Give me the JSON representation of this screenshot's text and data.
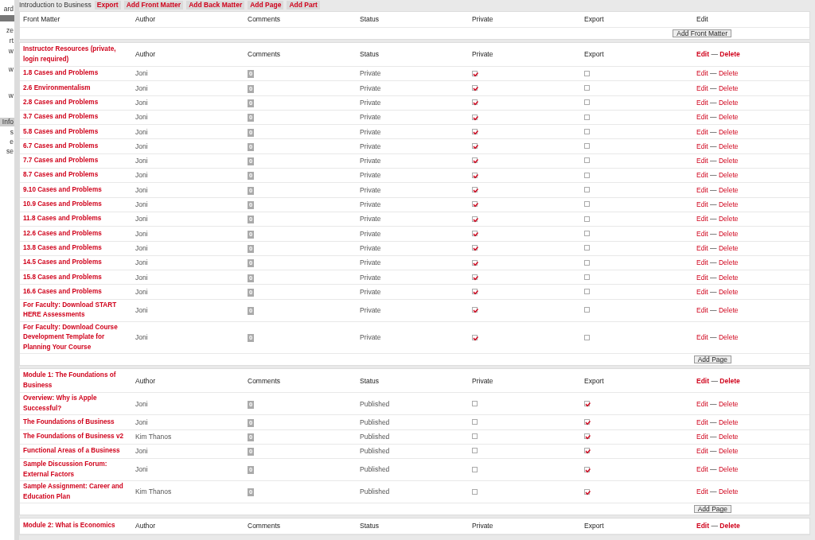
{
  "sidebar": {
    "items": [
      {
        "label": "ard",
        "selected": false
      },
      {
        "label": "ze",
        "selected": false
      },
      {
        "label": "rt",
        "selected": false
      },
      {
        "label": "w",
        "selected": false
      },
      {
        "label": "w",
        "selected": false
      },
      {
        "label": "w",
        "selected": false
      },
      {
        "label": "Info",
        "selected": true
      },
      {
        "label": "s",
        "selected": false
      },
      {
        "label": "e",
        "selected": false
      },
      {
        "label": "se",
        "selected": false
      }
    ]
  },
  "toolbar": {
    "book_title": "Introduction to Business",
    "buttons": [
      "Export",
      "Add Front Matter",
      "Add Back Matter",
      "Add Page",
      "Add Part"
    ]
  },
  "sections": [
    {
      "kind": "front_matter",
      "title": "Front Matter",
      "columns": [
        "Author",
        "Comments",
        "Status",
        "Private",
        "Export"
      ],
      "edit": "Edit",
      "add_button": "Add Front Matter"
    },
    {
      "kind": "part",
      "title": "Instructor Resources (private, login required)",
      "columns": [
        "Author",
        "Comments",
        "Status",
        "Private",
        "Export"
      ],
      "edit": "Edit",
      "separator": "—",
      "delete": "Delete",
      "add_button": "Add Page",
      "rows": [
        {
          "title": "1.8 Cases and Problems",
          "author": "Joni",
          "comments": "0",
          "status": "Private",
          "private": true,
          "export": false,
          "edit": "Edit",
          "separator": "—",
          "delete": "Delete"
        },
        {
          "title": "2.6 Environmentalism",
          "author": "Joni",
          "comments": "0",
          "status": "Private",
          "private": true,
          "export": false,
          "edit": "Edit",
          "separator": "—",
          "delete": "Delete"
        },
        {
          "title": "2.8 Cases and Problems",
          "author": "Joni",
          "comments": "0",
          "status": "Private",
          "private": true,
          "export": false,
          "edit": "Edit",
          "separator": "—",
          "delete": "Delete"
        },
        {
          "title": "3.7 Cases and Problems",
          "author": "Joni",
          "comments": "0",
          "status": "Private",
          "private": true,
          "export": false,
          "edit": "Edit",
          "separator": "—",
          "delete": "Delete"
        },
        {
          "title": "5.8 Cases and Problems",
          "author": "Joni",
          "comments": "0",
          "status": "Private",
          "private": true,
          "export": false,
          "edit": "Edit",
          "separator": "—",
          "delete": "Delete"
        },
        {
          "title": "6.7 Cases and Problems",
          "author": "Joni",
          "comments": "0",
          "status": "Private",
          "private": true,
          "export": false,
          "edit": "Edit",
          "separator": "—",
          "delete": "Delete"
        },
        {
          "title": "7.7 Cases and Problems",
          "author": "Joni",
          "comments": "0",
          "status": "Private",
          "private": true,
          "export": false,
          "edit": "Edit",
          "separator": "—",
          "delete": "Delete"
        },
        {
          "title": "8.7 Cases and Problems",
          "author": "Joni",
          "comments": "0",
          "status": "Private",
          "private": true,
          "export": false,
          "edit": "Edit",
          "separator": "—",
          "delete": "Delete"
        },
        {
          "title": "9.10 Cases and Problems",
          "author": "Joni",
          "comments": "0",
          "status": "Private",
          "private": true,
          "export": false,
          "edit": "Edit",
          "separator": "—",
          "delete": "Delete"
        },
        {
          "title": "10.9 Cases and Problems",
          "author": "Joni",
          "comments": "0",
          "status": "Private",
          "private": true,
          "export": false,
          "edit": "Edit",
          "separator": "—",
          "delete": "Delete"
        },
        {
          "title": "11.8 Cases and Problems",
          "author": "Joni",
          "comments": "0",
          "status": "Private",
          "private": true,
          "export": false,
          "edit": "Edit",
          "separator": "—",
          "delete": "Delete"
        },
        {
          "title": "12.6 Cases and Problems",
          "author": "Joni",
          "comments": "0",
          "status": "Private",
          "private": true,
          "export": false,
          "edit": "Edit",
          "separator": "—",
          "delete": "Delete"
        },
        {
          "title": "13.8 Cases and Problems",
          "author": "Joni",
          "comments": "0",
          "status": "Private",
          "private": true,
          "export": false,
          "edit": "Edit",
          "separator": "—",
          "delete": "Delete"
        },
        {
          "title": "14.5 Cases and Problems",
          "author": "Joni",
          "comments": "0",
          "status": "Private",
          "private": true,
          "export": false,
          "edit": "Edit",
          "separator": "—",
          "delete": "Delete"
        },
        {
          "title": "15.8 Cases and Problems",
          "author": "Joni",
          "comments": "0",
          "status": "Private",
          "private": true,
          "export": false,
          "edit": "Edit",
          "separator": "—",
          "delete": "Delete"
        },
        {
          "title": "16.6 Cases and Problems",
          "author": "Joni",
          "comments": "0",
          "status": "Private",
          "private": true,
          "export": false,
          "edit": "Edit",
          "separator": "—",
          "delete": "Delete"
        },
        {
          "title": "For Faculty: Download START HERE Assessments",
          "author": "Joni",
          "comments": "0",
          "status": "Private",
          "private": true,
          "export": false,
          "edit": "Edit",
          "separator": "—",
          "delete": "Delete"
        },
        {
          "title": "For Faculty: Download Course Development Template for Planning Your Course",
          "author": "Joni",
          "comments": "0",
          "status": "Private",
          "private": true,
          "export": false,
          "edit": "Edit",
          "separator": "—",
          "delete": "Delete"
        }
      ]
    },
    {
      "kind": "part",
      "title": "Module 1: The Foundations of Business",
      "columns": [
        "Author",
        "Comments",
        "Status",
        "Private",
        "Export"
      ],
      "edit": "Edit",
      "separator": "—",
      "delete": "Delete",
      "add_button": "Add Page",
      "rows": [
        {
          "title": "Overview: Why is Apple Successful?",
          "author": "Joni",
          "comments": "0",
          "status": "Published",
          "private": false,
          "export": true,
          "edit": "Edit",
          "separator": "—",
          "delete": "Delete"
        },
        {
          "title": "The Foundations of Business",
          "author": "Joni",
          "comments": "0",
          "status": "Published",
          "private": false,
          "export": true,
          "edit": "Edit",
          "separator": "—",
          "delete": "Delete"
        },
        {
          "title": "The Foundations of Business v2",
          "author": "Kim Thanos",
          "comments": "0",
          "status": "Published",
          "private": false,
          "export": true,
          "edit": "Edit",
          "separator": "—",
          "delete": "Delete"
        },
        {
          "title": "Functional Areas of a Business",
          "author": "Joni",
          "comments": "0",
          "status": "Published",
          "private": false,
          "export": true,
          "edit": "Edit",
          "separator": "—",
          "delete": "Delete"
        },
        {
          "title": "Sample Discussion Forum: External Factors",
          "author": "Joni",
          "comments": "0",
          "status": "Published",
          "private": false,
          "export": true,
          "edit": "Edit",
          "separator": "—",
          "delete": "Delete"
        },
        {
          "title": "Sample Assignment: Career and Education Plan",
          "author": "Kim Thanos",
          "comments": "0",
          "status": "Published",
          "private": false,
          "export": true,
          "edit": "Edit",
          "separator": "—",
          "delete": "Delete"
        }
      ]
    },
    {
      "kind": "part",
      "title": "Module 2: What is Economics",
      "columns": [
        "Author",
        "Comments",
        "Status",
        "Private",
        "Export"
      ],
      "edit": "Edit",
      "separator": "—",
      "delete": "Delete"
    }
  ]
}
